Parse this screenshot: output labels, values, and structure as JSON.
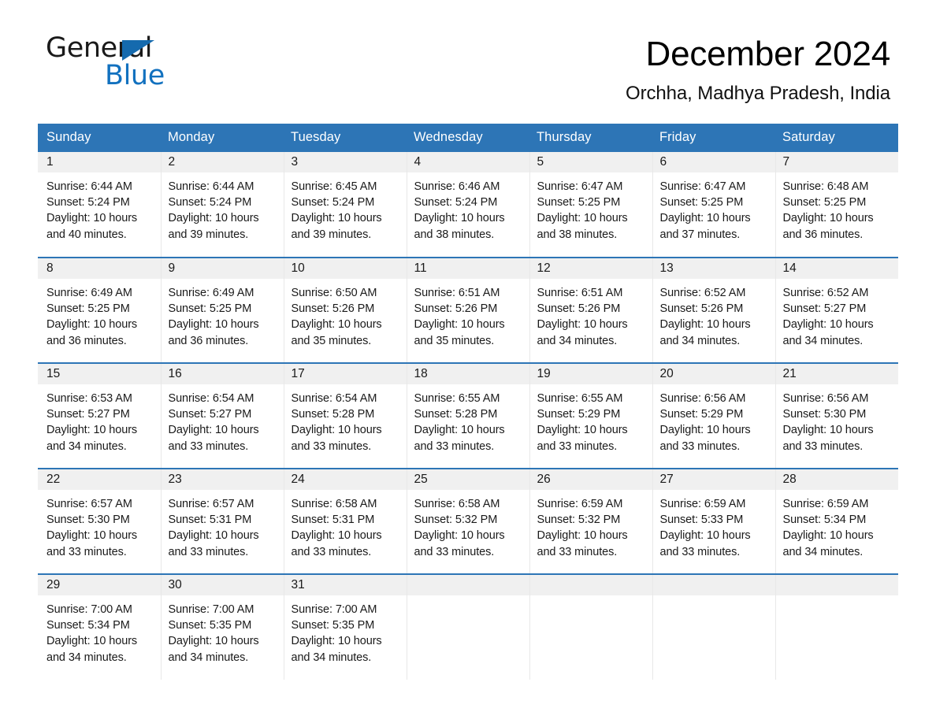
{
  "brand": {
    "name_part1": "General",
    "name_part2": "Blue",
    "accent_color": "#1271bf",
    "triangle_color": "#156aae",
    "icon": "triangle-flag-icon"
  },
  "header": {
    "title": "December 2024",
    "subtitle": "Orchha, Madhya Pradesh, India"
  },
  "theme": {
    "header_row_color": "#2d75b6",
    "daynum_band_color": "#f0f0f0",
    "divider_color": "#2d75b6"
  },
  "weekday_headers": [
    "Sunday",
    "Monday",
    "Tuesday",
    "Wednesday",
    "Thursday",
    "Friday",
    "Saturday"
  ],
  "weeks": [
    [
      {
        "day": "1",
        "sunrise": "Sunrise: 6:44 AM",
        "sunset": "Sunset: 5:24 PM",
        "daylight": "Daylight: 10 hours and 40 minutes."
      },
      {
        "day": "2",
        "sunrise": "Sunrise: 6:44 AM",
        "sunset": "Sunset: 5:24 PM",
        "daylight": "Daylight: 10 hours and 39 minutes."
      },
      {
        "day": "3",
        "sunrise": "Sunrise: 6:45 AM",
        "sunset": "Sunset: 5:24 PM",
        "daylight": "Daylight: 10 hours and 39 minutes."
      },
      {
        "day": "4",
        "sunrise": "Sunrise: 6:46 AM",
        "sunset": "Sunset: 5:24 PM",
        "daylight": "Daylight: 10 hours and 38 minutes."
      },
      {
        "day": "5",
        "sunrise": "Sunrise: 6:47 AM",
        "sunset": "Sunset: 5:25 PM",
        "daylight": "Daylight: 10 hours and 38 minutes."
      },
      {
        "day": "6",
        "sunrise": "Sunrise: 6:47 AM",
        "sunset": "Sunset: 5:25 PM",
        "daylight": "Daylight: 10 hours and 37 minutes."
      },
      {
        "day": "7",
        "sunrise": "Sunrise: 6:48 AM",
        "sunset": "Sunset: 5:25 PM",
        "daylight": "Daylight: 10 hours and 36 minutes."
      }
    ],
    [
      {
        "day": "8",
        "sunrise": "Sunrise: 6:49 AM",
        "sunset": "Sunset: 5:25 PM",
        "daylight": "Daylight: 10 hours and 36 minutes."
      },
      {
        "day": "9",
        "sunrise": "Sunrise: 6:49 AM",
        "sunset": "Sunset: 5:25 PM",
        "daylight": "Daylight: 10 hours and 36 minutes."
      },
      {
        "day": "10",
        "sunrise": "Sunrise: 6:50 AM",
        "sunset": "Sunset: 5:26 PM",
        "daylight": "Daylight: 10 hours and 35 minutes."
      },
      {
        "day": "11",
        "sunrise": "Sunrise: 6:51 AM",
        "sunset": "Sunset: 5:26 PM",
        "daylight": "Daylight: 10 hours and 35 minutes."
      },
      {
        "day": "12",
        "sunrise": "Sunrise: 6:51 AM",
        "sunset": "Sunset: 5:26 PM",
        "daylight": "Daylight: 10 hours and 34 minutes."
      },
      {
        "day": "13",
        "sunrise": "Sunrise: 6:52 AM",
        "sunset": "Sunset: 5:26 PM",
        "daylight": "Daylight: 10 hours and 34 minutes."
      },
      {
        "day": "14",
        "sunrise": "Sunrise: 6:52 AM",
        "sunset": "Sunset: 5:27 PM",
        "daylight": "Daylight: 10 hours and 34 minutes."
      }
    ],
    [
      {
        "day": "15",
        "sunrise": "Sunrise: 6:53 AM",
        "sunset": "Sunset: 5:27 PM",
        "daylight": "Daylight: 10 hours and 34 minutes."
      },
      {
        "day": "16",
        "sunrise": "Sunrise: 6:54 AM",
        "sunset": "Sunset: 5:27 PM",
        "daylight": "Daylight: 10 hours and 33 minutes."
      },
      {
        "day": "17",
        "sunrise": "Sunrise: 6:54 AM",
        "sunset": "Sunset: 5:28 PM",
        "daylight": "Daylight: 10 hours and 33 minutes."
      },
      {
        "day": "18",
        "sunrise": "Sunrise: 6:55 AM",
        "sunset": "Sunset: 5:28 PM",
        "daylight": "Daylight: 10 hours and 33 minutes."
      },
      {
        "day": "19",
        "sunrise": "Sunrise: 6:55 AM",
        "sunset": "Sunset: 5:29 PM",
        "daylight": "Daylight: 10 hours and 33 minutes."
      },
      {
        "day": "20",
        "sunrise": "Sunrise: 6:56 AM",
        "sunset": "Sunset: 5:29 PM",
        "daylight": "Daylight: 10 hours and 33 minutes."
      },
      {
        "day": "21",
        "sunrise": "Sunrise: 6:56 AM",
        "sunset": "Sunset: 5:30 PM",
        "daylight": "Daylight: 10 hours and 33 minutes."
      }
    ],
    [
      {
        "day": "22",
        "sunrise": "Sunrise: 6:57 AM",
        "sunset": "Sunset: 5:30 PM",
        "daylight": "Daylight: 10 hours and 33 minutes."
      },
      {
        "day": "23",
        "sunrise": "Sunrise: 6:57 AM",
        "sunset": "Sunset: 5:31 PM",
        "daylight": "Daylight: 10 hours and 33 minutes."
      },
      {
        "day": "24",
        "sunrise": "Sunrise: 6:58 AM",
        "sunset": "Sunset: 5:31 PM",
        "daylight": "Daylight: 10 hours and 33 minutes."
      },
      {
        "day": "25",
        "sunrise": "Sunrise: 6:58 AM",
        "sunset": "Sunset: 5:32 PM",
        "daylight": "Daylight: 10 hours and 33 minutes."
      },
      {
        "day": "26",
        "sunrise": "Sunrise: 6:59 AM",
        "sunset": "Sunset: 5:32 PM",
        "daylight": "Daylight: 10 hours and 33 minutes."
      },
      {
        "day": "27",
        "sunrise": "Sunrise: 6:59 AM",
        "sunset": "Sunset: 5:33 PM",
        "daylight": "Daylight: 10 hours and 33 minutes."
      },
      {
        "day": "28",
        "sunrise": "Sunrise: 6:59 AM",
        "sunset": "Sunset: 5:34 PM",
        "daylight": "Daylight: 10 hours and 34 minutes."
      }
    ],
    [
      {
        "day": "29",
        "sunrise": "Sunrise: 7:00 AM",
        "sunset": "Sunset: 5:34 PM",
        "daylight": "Daylight: 10 hours and 34 minutes."
      },
      {
        "day": "30",
        "sunrise": "Sunrise: 7:00 AM",
        "sunset": "Sunset: 5:35 PM",
        "daylight": "Daylight: 10 hours and 34 minutes."
      },
      {
        "day": "31",
        "sunrise": "Sunrise: 7:00 AM",
        "sunset": "Sunset: 5:35 PM",
        "daylight": "Daylight: 10 hours and 34 minutes."
      },
      {
        "day": "",
        "sunrise": "",
        "sunset": "",
        "daylight": ""
      },
      {
        "day": "",
        "sunrise": "",
        "sunset": "",
        "daylight": ""
      },
      {
        "day": "",
        "sunrise": "",
        "sunset": "",
        "daylight": ""
      },
      {
        "day": "",
        "sunrise": "",
        "sunset": "",
        "daylight": ""
      }
    ]
  ]
}
